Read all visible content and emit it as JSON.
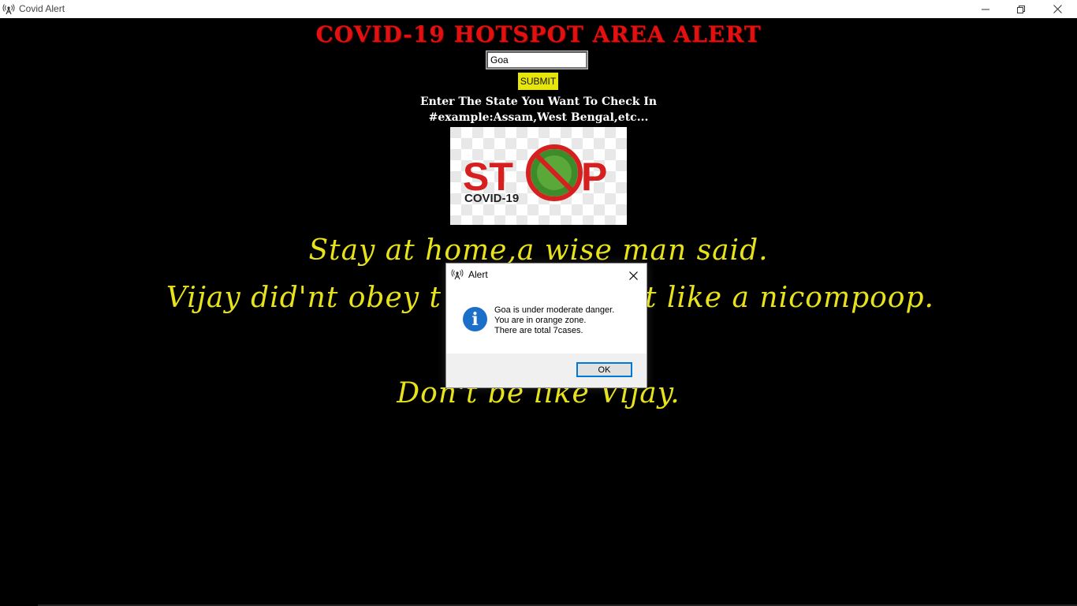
{
  "window": {
    "title": "Covid Alert",
    "icon": "antenna-icon"
  },
  "main": {
    "title": "COVID-19 HOTSPOT AREA ALERT",
    "state_input_value": "Goa",
    "submit_label": "SUBMIT",
    "instruction_line1": "Enter The State You Want To Check In",
    "instruction_line2": "#example:Assam,West Bengal,etc...",
    "image": {
      "word_st": "ST",
      "word_p": "P",
      "caption": "COVID-19"
    },
    "poem": [
      "Stay at home,a wise man said.",
      "Vijay did'nt obey t",
      "t like a nicompoop.",
      "Don't be like Vijay."
    ]
  },
  "dialog": {
    "title": "Alert",
    "message_lines": [
      "Goa is under moderate danger.",
      "You are in orange zone.",
      "There are total 7cases."
    ],
    "ok_label": "OK"
  },
  "colors": {
    "title_red": "#e31010",
    "poem_yellow": "#e8e21a",
    "submit_yellow": "#e6e60a",
    "info_blue": "#1b6fc8"
  }
}
